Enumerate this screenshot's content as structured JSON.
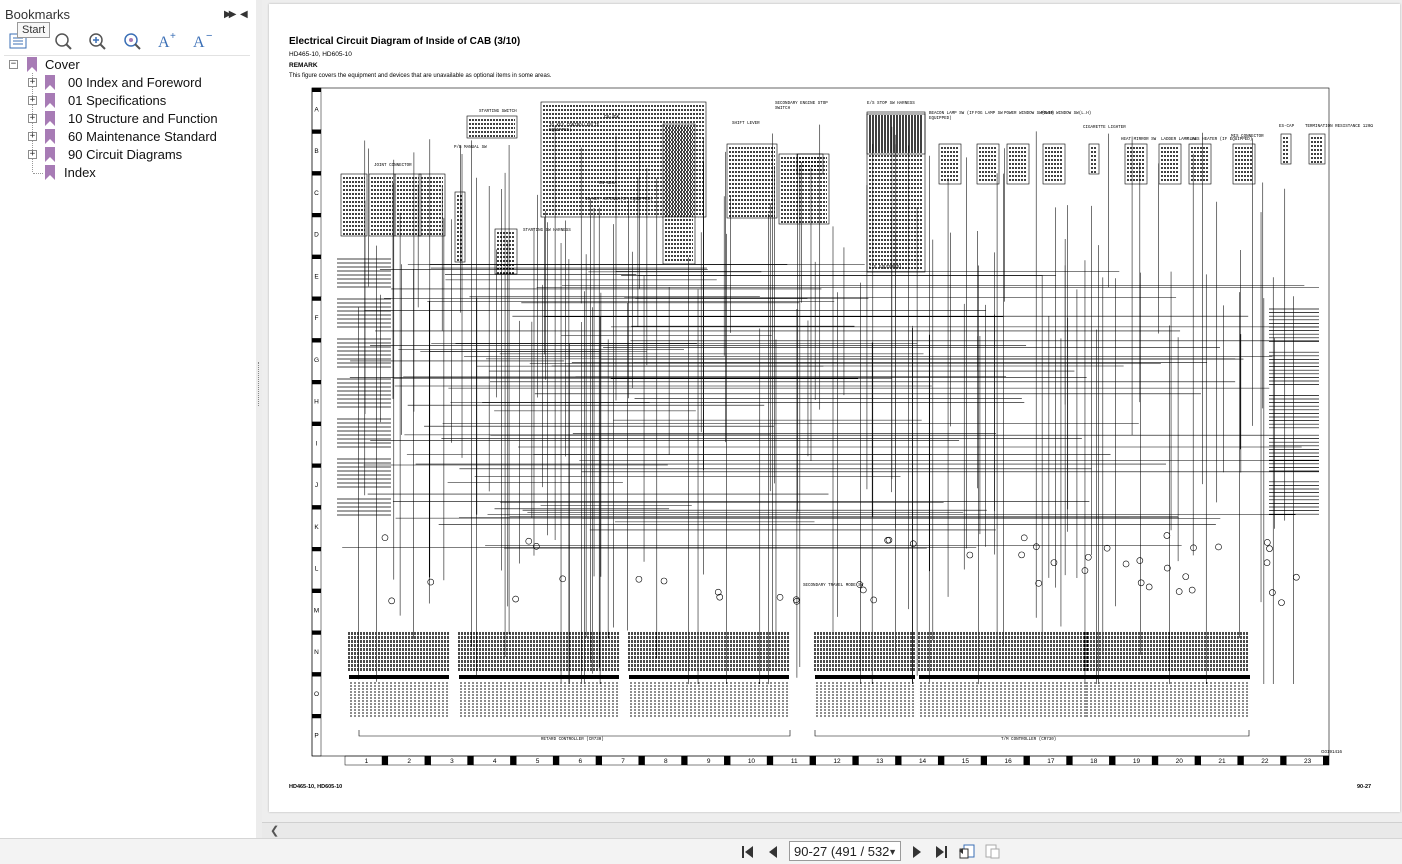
{
  "sidebar": {
    "title": "Bookmarks",
    "tooltip": "Start",
    "tree": [
      {
        "label": "Cover",
        "level": 0,
        "expanded": true
      },
      {
        "label": "00 Index and Foreword",
        "level": 1,
        "expanded": false
      },
      {
        "label": "01 Specifications",
        "level": 1,
        "expanded": false
      },
      {
        "label": "10 Structure and Function",
        "level": 1,
        "expanded": false
      },
      {
        "label": "60 Maintenance Standard",
        "level": 1,
        "expanded": false
      },
      {
        "label": "90 Circuit Diagrams",
        "level": 1,
        "expanded": false
      },
      {
        "label": "Index",
        "level": 1,
        "expanded": null
      }
    ],
    "toolbar_icons": [
      "bookmark-list-icon",
      "expand-bookmark-icon",
      "collapse-bookmark-icon",
      "search-bookmark-icon",
      "increase-font-icon",
      "decrease-font-icon"
    ]
  },
  "document": {
    "title": "Electrical Circuit Diagram of Inside of CAB (3/10)",
    "models": "HD465-10, HD605-10",
    "remark_label": "REMARK",
    "remark_text": "This figure covers the equipment and devices that are unavailable as optional items in some areas.",
    "footer_left": "HD465-10, HD605-10",
    "footer_right": "90-27",
    "figure_code": "G0191416",
    "row_letters": [
      "A",
      "B",
      "C",
      "D",
      "E",
      "F",
      "G",
      "H",
      "I",
      "J",
      "K",
      "L",
      "M",
      "N",
      "O",
      "P"
    ],
    "column_numbers": [
      "1",
      "2",
      "3",
      "4",
      "5",
      "6",
      "7",
      "8",
      "9",
      "10",
      "11",
      "12",
      "13",
      "14",
      "15",
      "16",
      "17",
      "18",
      "19",
      "20",
      "21",
      "22",
      "23"
    ],
    "component_labels": [
      "JOINT CONNECTOR",
      "STARTING SWITCH",
      "P/B MANUAL SW",
      "STARTING SW HARNESS",
      "CN-4DK",
      "CN-4DKA",
      "IO KEY CONTROLLER(IF EQUIPPED)",
      "IO KEY ANTENNA(IF EQUIPPED)",
      "SHIFT LEVER",
      "SECONDARY ENGINE STOP SWITCH",
      "E/S STOP SW HARNESS",
      "(IF EQUIPPED)",
      "BEACON LAMP SW (IF EQUIPPED)",
      "FOG LAMP SW",
      "POWER WINDOW SW(R.H)",
      "POWER WINDOW SW(L.H)",
      "CIGARETTE LIGHTER",
      "HEAT MIRROR SW",
      "LADDER LAMP SW",
      "GLASS HEATER (IF EQUIPPED)",
      "MIS CONNECTOR",
      "ES-CAP",
      "TERMINATION RESISTANCE 120Ω",
      "SECONDARY TRAVEL MODE SW",
      "RETARD CONTROLLER (CR730)",
      "T/M CONTROLLER (CR730)"
    ]
  },
  "navigation": {
    "page_label": "90-27 (491 / 532"
  },
  "colors": {
    "bookmark": "#a77bb5",
    "drawing_line": "#000000",
    "viewer_bg": "#eeeeee"
  }
}
